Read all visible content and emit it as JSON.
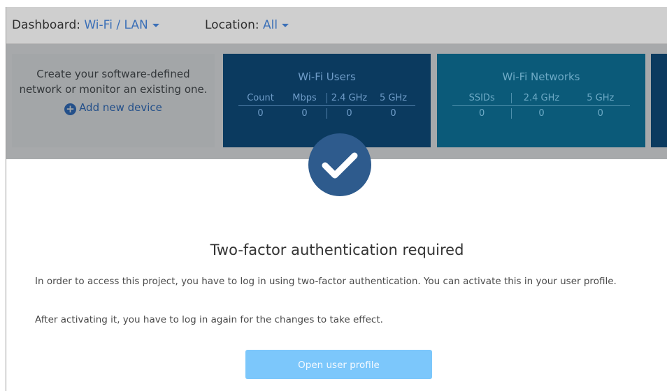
{
  "topbar": {
    "dashboard_label": "Dashboard:",
    "dashboard_value": "Wi-Fi / LAN",
    "location_label": "Location:",
    "location_value": "All"
  },
  "create_card": {
    "text": "Create your software-defined network or monitor an existing one.",
    "add_label": "Add new device"
  },
  "wifi_users": {
    "title": "Wi-Fi Users",
    "headers": [
      "Count",
      "Mbps",
      "2.4 GHz",
      "5 GHz"
    ],
    "values": [
      "0",
      "0",
      "0",
      "0"
    ]
  },
  "wifi_networks": {
    "title": "Wi-Fi Networks",
    "headers": [
      "SSIDs",
      "2.4 GHz",
      "5 GHz"
    ],
    "values": [
      "0",
      "0",
      "0"
    ]
  },
  "modal": {
    "icon": "check-circle-icon",
    "title": "Two-factor authentication required",
    "paragraph1": "In order to access this project, you have to log in using two-factor authentication. You can activate this in your user profile.",
    "paragraph2": "After activating it, you have to log in again for the changes to take effect.",
    "button_label": "Open user profile"
  },
  "colors": {
    "accent": "#2e5b8d",
    "button": "#7cc7fb",
    "link": "#3a6fb7"
  }
}
